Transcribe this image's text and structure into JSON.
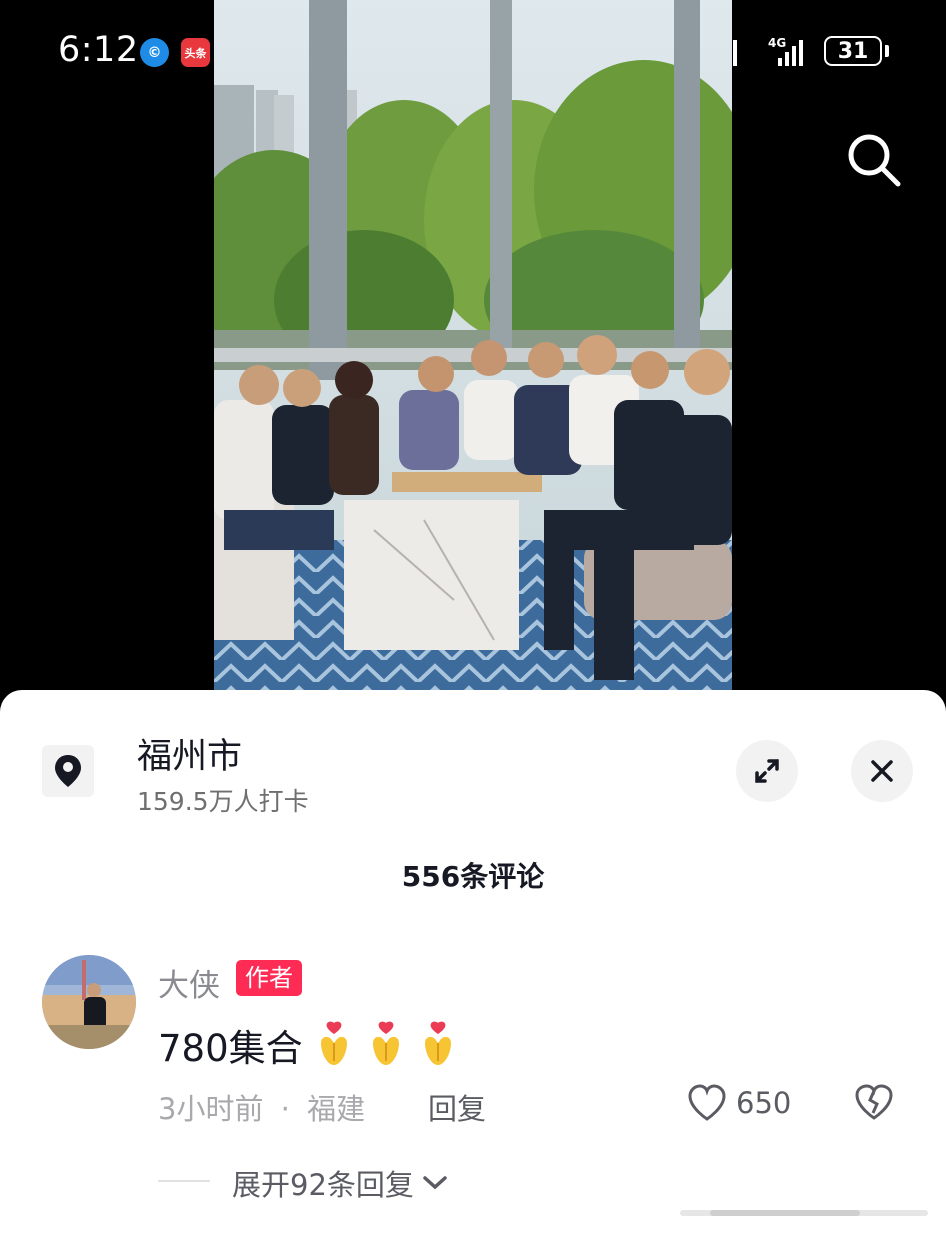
{
  "status_bar": {
    "time": "6:12",
    "app_icons": [
      "browser-icon",
      "toutiao-icon",
      "reader-icon",
      "map-icon",
      "video-icon"
    ],
    "app_icon_labels": {
      "toutiao": "头条"
    },
    "network_1": "4G",
    "network_2": "4G",
    "battery": "31"
  },
  "video": {
    "description_icon": "group-photo"
  },
  "location": {
    "title": "福州市",
    "checkins": "159.5万人打卡"
  },
  "comments": {
    "count_label": "556条评论",
    "items": [
      {
        "author": "大侠",
        "badge": "作者",
        "text": "780集合",
        "emoji_count": 3,
        "time": "3小时前",
        "region": "福建",
        "meta_separator": "·",
        "reply_label": "回复",
        "likes": "650",
        "expand_label": "展开92条回复"
      }
    ]
  },
  "colors": {
    "accent": "#fe2c55",
    "text_primary": "#161823",
    "text_secondary": "#8a8b91"
  }
}
